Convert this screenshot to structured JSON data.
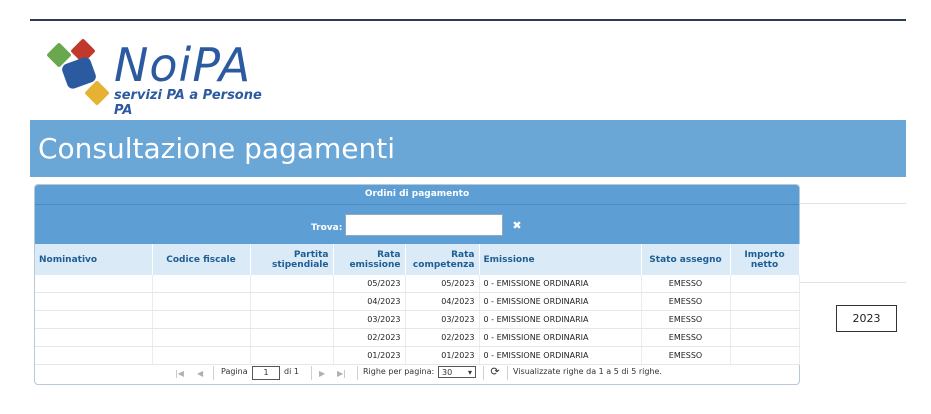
{
  "logo": {
    "brand": "NoiPA",
    "tagline": "servizi PA a Persone PA"
  },
  "page": {
    "title": "Consultazione pagamenti"
  },
  "panel": {
    "header": "Ordini di pagamento"
  },
  "search": {
    "label": "Trova:",
    "value": "",
    "clear_icon": "✖"
  },
  "table": {
    "columns": [
      "Nominativo",
      "Codice fiscale",
      "Partita stipendiale",
      "Rata emissione",
      "Rata competenza",
      "Emissione",
      "Stato assegno",
      "Importo netto"
    ],
    "rows": [
      {
        "rata_emissione": "05/2023",
        "rata_competenza": "05/2023",
        "emissione": "0 - EMISSIONE ORDINARIA",
        "stato": "EMESSO"
      },
      {
        "rata_emissione": "04/2023",
        "rata_competenza": "04/2023",
        "emissione": "0 - EMISSIONE ORDINARIA",
        "stato": "EMESSO"
      },
      {
        "rata_emissione": "03/2023",
        "rata_competenza": "03/2023",
        "emissione": "0 - EMISSIONE ORDINARIA",
        "stato": "EMESSO"
      },
      {
        "rata_emissione": "02/2023",
        "rata_competenza": "02/2023",
        "emissione": "0 - EMISSIONE ORDINARIA",
        "stato": "EMESSO"
      },
      {
        "rata_emissione": "01/2023",
        "rata_competenza": "01/2023",
        "emissione": "0 - EMISSIONE ORDINARIA",
        "stato": "EMESSO"
      }
    ]
  },
  "pager": {
    "page_label": "Pagina",
    "page_value": "1",
    "of_label": "di 1",
    "rows_per_page_label": "Righe per pagina:",
    "rows_per_page_value": "30",
    "summary": "Visualizzate righe da 1 a 5 di 5 righe."
  },
  "year": {
    "value": "2023"
  }
}
